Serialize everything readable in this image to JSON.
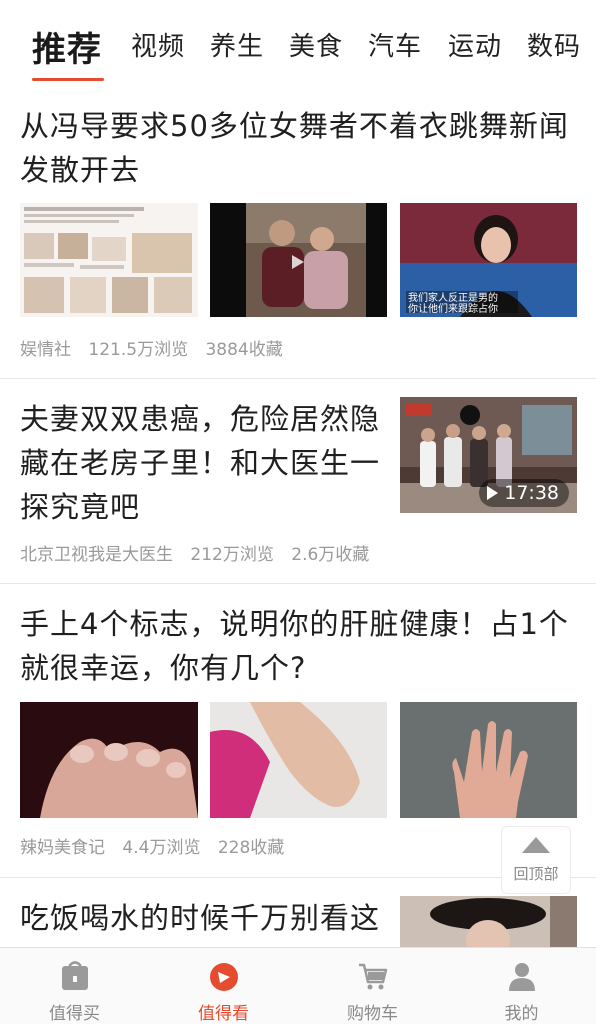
{
  "tabs": [
    {
      "label": "推荐",
      "active": true
    },
    {
      "label": "视频"
    },
    {
      "label": "养生"
    },
    {
      "label": "美食"
    },
    {
      "label": "汽车"
    },
    {
      "label": "运动"
    },
    {
      "label": "数码"
    }
  ],
  "feed": [
    {
      "title_lines": [
        "从冯导要求50多位女舞者不着衣跳舞新闻",
        "发散开去"
      ],
      "source": "娱情社",
      "views": "121.5万浏览",
      "favorites": "3884收藏",
      "thumb_text": {
        "caption_line1": "我们家人反正是男的",
        "caption_line2": "你让他们来跟踪占你"
      }
    },
    {
      "title_lines": [
        "夫妻双双患癌，危险居然隐",
        "藏在老房子里！和大医生一",
        "探究竟吧"
      ],
      "source": "北京卫视我是大医生",
      "views": "212万浏览",
      "favorites": "2.6万收藏",
      "duration": "17:38"
    },
    {
      "title_lines": [
        "手上4个标志，说明你的肝脏健康！占1个",
        "就很幸运，你有几个?"
      ],
      "source": "辣妈美食记",
      "views": "4.4万浏览",
      "favorites": "228收藏"
    },
    {
      "title_lines": [
        "吃饭喝水的时候千万别看这"
      ]
    }
  ],
  "back_to_top": "回顶部",
  "bottom_nav": [
    {
      "label": "值得买",
      "icon": "bag-icon"
    },
    {
      "label": "值得看",
      "icon": "discover-icon",
      "active": true
    },
    {
      "label": "购物车",
      "icon": "cart-icon"
    },
    {
      "label": "我的",
      "icon": "user-icon"
    }
  ],
  "colors": {
    "accent": "#e54b2e",
    "meta": "#9a9a9a",
    "nav_inactive": "#8a8a8a"
  }
}
